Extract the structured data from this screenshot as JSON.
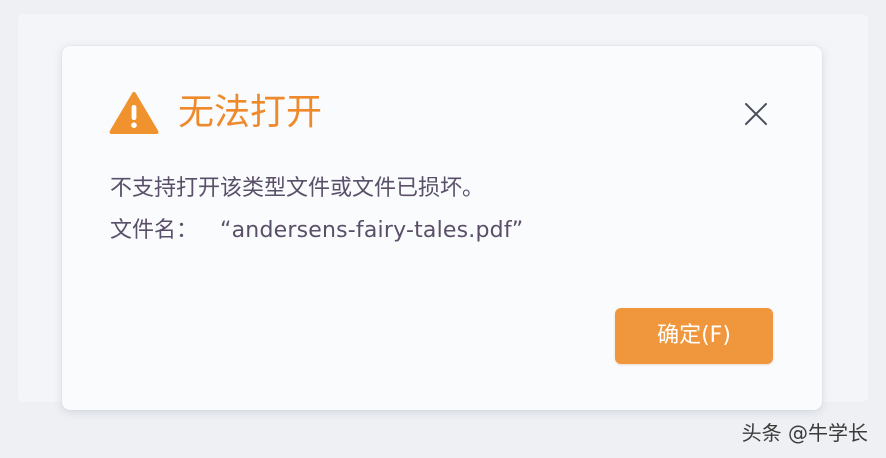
{
  "dialog": {
    "title": "无法打开",
    "icon": "warning-icon",
    "message": "不支持打开该类型文件或文件已损坏。",
    "file_label": "文件名：",
    "file_name": "“andersens-fairy-tales.pdf”",
    "ok_label": "确定(F)",
    "close_icon": "close-icon"
  },
  "watermark": {
    "text": "头条 @牛学长"
  },
  "colors": {
    "accent": "#ef8a2c",
    "button": "#f0963c",
    "text": "#5a4f68"
  }
}
